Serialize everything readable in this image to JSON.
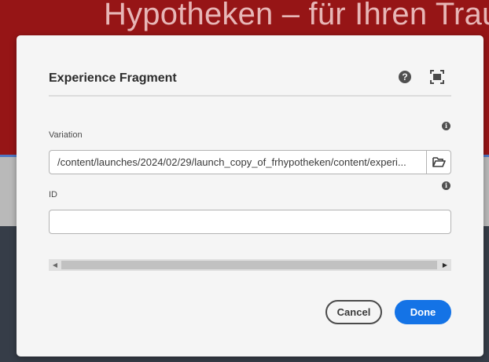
{
  "background": {
    "hero_title": "Hypotheken – für Ihren Trau"
  },
  "dialog": {
    "title": "Experience Fragment",
    "help_icon": "help-icon",
    "fullscreen_icon": "fullscreen-icon",
    "variation": {
      "label": "Variation",
      "value": "/content/launches/2024/02/29/launch_copy_of_frhypotheken/content/experi...",
      "browse_icon": "folder-icon"
    },
    "id": {
      "label": "ID",
      "value": ""
    },
    "buttons": {
      "cancel": "Cancel",
      "done": "Done"
    }
  },
  "colors": {
    "hero_red": "#961516",
    "accent_blue": "#1473e6",
    "dark_footer": "#363d48"
  }
}
